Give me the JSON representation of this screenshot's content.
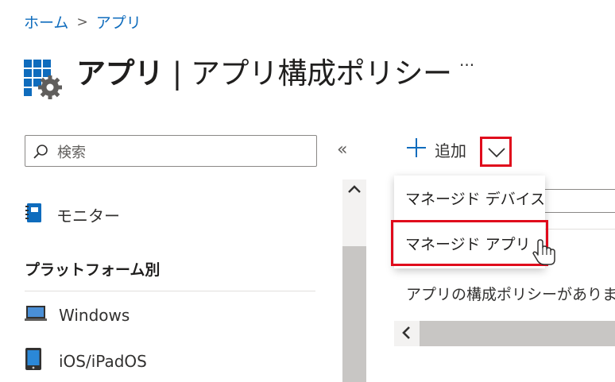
{
  "breadcrumb": {
    "home": "ホーム",
    "separator": ">",
    "current": "アプリ"
  },
  "title": {
    "bold": "アプリ",
    "rest": " | アプリ構成ポリシー"
  },
  "more_label": "···",
  "sidebar": {
    "search_placeholder": "検索",
    "collapse_label": "«",
    "items": [
      {
        "label": "モニター",
        "icon": "monitor-book-icon"
      }
    ],
    "section_heading": "プラットフォーム別",
    "platforms": [
      {
        "label": "Windows",
        "icon": "windows-laptop-icon"
      },
      {
        "label": "iOS/iPadOS",
        "icon": "ios-tablet-icon"
      }
    ]
  },
  "toolbar": {
    "add_label": "追加",
    "add_icon": "plus-icon",
    "dropdown_icon": "chevron-down-icon"
  },
  "dropdown_menu": {
    "items": [
      {
        "label": "マネージド デバイス"
      },
      {
        "label": "マネージド アプリ"
      }
    ]
  },
  "main": {
    "empty_message": "アプリの構成ポリシーがありませ"
  },
  "colors": {
    "accent": "#0f6cbd",
    "highlight": "#e00b1c"
  }
}
